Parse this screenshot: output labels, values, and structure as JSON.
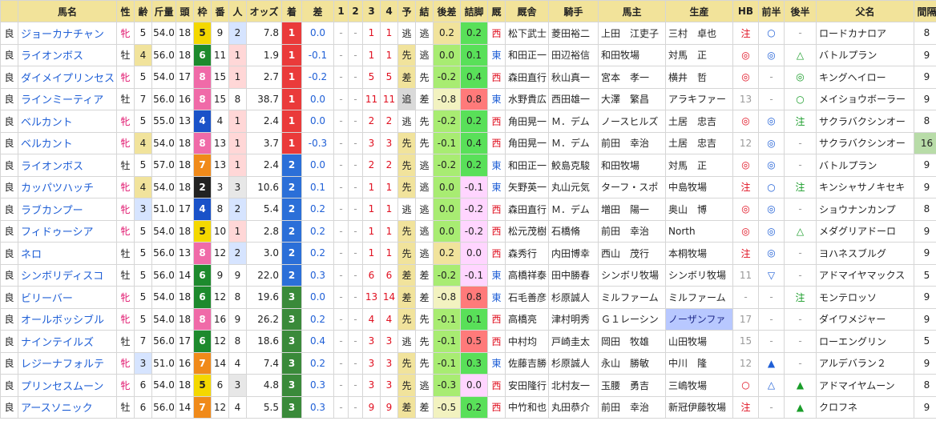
{
  "headers": [
    "",
    "馬名",
    "性",
    "齢",
    "斤量",
    "頭",
    "枠",
    "番",
    "人",
    "オッズ",
    "着",
    "差",
    "1",
    "2",
    "3",
    "4",
    "予",
    "結",
    "後差",
    "詰脚",
    "厩",
    "厩舎",
    "騎手",
    "馬主",
    "生産",
    "HB",
    "前半",
    "後半",
    "父名",
    "間隔"
  ],
  "rows": [
    {
      "baba": "良",
      "name": "ジョーカナチャン",
      "sex": "牝",
      "age": "5",
      "kin": "54.0",
      "tou": "18",
      "waku": "5",
      "ban": "9",
      "ninki": "2",
      "odds": "7.8",
      "chaku": "1",
      "sa": "0.0",
      "c1": "-",
      "c2": "-",
      "c3": "1",
      "c4": "1",
      "yo": "逃",
      "ke": "逃",
      "kosa": "0.2",
      "tsume": "0.2",
      "ew": "西",
      "stable": "松下武士",
      "jockey": "菱田裕二",
      "owner": "上田　江吏子",
      "breeder": "三村　卓也",
      "hb": "注",
      "zen": "○",
      "kou": "-",
      "sire": "ロードカナロア",
      "kankaku": "8"
    },
    {
      "baba": "良",
      "name": "ライオンボス",
      "sex": "牡",
      "age": "4",
      "kin": "56.0",
      "tou": "18",
      "waku": "6",
      "ban": "11",
      "ninki": "1",
      "odds": "1.9",
      "chaku": "1",
      "sa": "-0.1",
      "c1": "-",
      "c2": "-",
      "c3": "1",
      "c4": "1",
      "yo": "先",
      "ke": "逃",
      "kosa": "0.0",
      "tsume": "0.1",
      "ew": "東",
      "stable": "和田正一",
      "jockey": "田辺裕信",
      "owner": "和田牧場",
      "breeder": "対馬　正",
      "hb": "◎",
      "zen": "◎",
      "kou": "△",
      "sire": "バトルプラン",
      "kankaku": "9"
    },
    {
      "baba": "良",
      "name": "ダイメイプリンセス",
      "sex": "牝",
      "age": "5",
      "kin": "54.0",
      "tou": "17",
      "waku": "8",
      "ban": "15",
      "ninki": "1",
      "odds": "2.7",
      "chaku": "1",
      "sa": "-0.2",
      "c1": "-",
      "c2": "-",
      "c3": "5",
      "c4": "5",
      "yo": "差",
      "ke": "先",
      "kosa": "-0.2",
      "tsume": "0.4",
      "ew": "西",
      "stable": "森田直行",
      "jockey": "秋山真一",
      "owner": "宮本　孝一",
      "breeder": "横井　哲",
      "hb": "◎",
      "zen": "-",
      "kou": "◎",
      "sire": "キングヘイロー",
      "kankaku": "9"
    },
    {
      "baba": "良",
      "name": "ラインミーティア",
      "sex": "牡",
      "age": "7",
      "kin": "56.0",
      "tou": "16",
      "waku": "8",
      "ban": "15",
      "ninki": "8",
      "odds": "38.7",
      "chaku": "1",
      "sa": "0.0",
      "c1": "-",
      "c2": "-",
      "c3": "11",
      "c4": "11",
      "yo": "追",
      "ke": "差",
      "kosa": "-0.8",
      "tsume": "0.8",
      "ew": "東",
      "stable": "水野貴広",
      "jockey": "西田雄一",
      "owner": "大澤　繁昌",
      "breeder": "アラキファー",
      "hb": "13",
      "zen": "-",
      "kou": "○",
      "sire": "メイショウボーラー",
      "kankaku": "9"
    },
    {
      "baba": "良",
      "name": "ベルカント",
      "sex": "牝",
      "age": "5",
      "kin": "55.0",
      "tou": "13",
      "waku": "4",
      "ban": "4",
      "ninki": "1",
      "odds": "2.4",
      "chaku": "1",
      "sa": "0.0",
      "c1": "-",
      "c2": "-",
      "c3": "2",
      "c4": "2",
      "yo": "逃",
      "ke": "先",
      "kosa": "-0.2",
      "tsume": "0.2",
      "ew": "西",
      "stable": "角田晃一",
      "jockey": "Ｍ．デム",
      "owner": "ノースヒルズ",
      "breeder": "土居　忠吉",
      "hb": "◎",
      "zen": "◎",
      "kou": "注",
      "sire": "サクラバクシンオー",
      "kankaku": "8"
    },
    {
      "baba": "良",
      "name": "ベルカント",
      "sex": "牝",
      "age": "4",
      "kin": "54.0",
      "tou": "18",
      "waku": "8",
      "ban": "13",
      "ninki": "1",
      "odds": "3.7",
      "chaku": "1",
      "sa": "-0.3",
      "c1": "-",
      "c2": "-",
      "c3": "3",
      "c4": "3",
      "yo": "先",
      "ke": "先",
      "kosa": "-0.1",
      "tsume": "0.4",
      "ew": "西",
      "stable": "角田晃一",
      "jockey": "Ｍ．デム",
      "owner": "前田　幸治",
      "breeder": "土居　忠吉",
      "hb": "12",
      "zen": "◎",
      "kou": "-",
      "sire": "サクラバクシンオー",
      "kankaku": "16"
    },
    {
      "baba": "良",
      "name": "ライオンボス",
      "sex": "牡",
      "age": "5",
      "kin": "57.0",
      "tou": "18",
      "waku": "7",
      "ban": "13",
      "ninki": "1",
      "odds": "2.4",
      "chaku": "2",
      "sa": "0.0",
      "c1": "-",
      "c2": "-",
      "c3": "2",
      "c4": "2",
      "yo": "先",
      "ke": "逃",
      "kosa": "-0.2",
      "tsume": "0.2",
      "ew": "東",
      "stable": "和田正一",
      "jockey": "鮫島克駿",
      "owner": "和田牧場",
      "breeder": "対馬　正",
      "hb": "◎",
      "zen": "◎",
      "kou": "-",
      "sire": "バトルプラン",
      "kankaku": "9"
    },
    {
      "baba": "良",
      "name": "カッパツハッチ",
      "sex": "牝",
      "age": "4",
      "kin": "54.0",
      "tou": "18",
      "waku": "2",
      "ban": "3",
      "ninki": "3",
      "odds": "10.6",
      "chaku": "2",
      "sa": "0.1",
      "c1": "-",
      "c2": "-",
      "c3": "1",
      "c4": "1",
      "yo": "先",
      "ke": "逃",
      "kosa": "0.0",
      "tsume": "-0.1",
      "ew": "東",
      "stable": "矢野英一",
      "jockey": "丸山元気",
      "owner": "ターフ・スポ",
      "breeder": "中島牧場",
      "hb": "注",
      "zen": "○",
      "kou": "注",
      "sire": "キンシャサノキセキ",
      "kankaku": "9"
    },
    {
      "baba": "良",
      "name": "ラブカンプー",
      "sex": "牝",
      "age": "3",
      "kin": "51.0",
      "tou": "17",
      "waku": "4",
      "ban": "8",
      "ninki": "2",
      "odds": "5.4",
      "chaku": "2",
      "sa": "0.2",
      "c1": "-",
      "c2": "-",
      "c3": "1",
      "c4": "1",
      "yo": "逃",
      "ke": "逃",
      "kosa": "0.0",
      "tsume": "-0.2",
      "ew": "西",
      "stable": "森田直行",
      "jockey": "Ｍ．デム",
      "owner": "増田　陽一",
      "breeder": "奥山　博",
      "hb": "◎",
      "zen": "◎",
      "kou": "-",
      "sire": "ショウナンカンプ",
      "kankaku": "8"
    },
    {
      "baba": "良",
      "name": "フィドゥーシア",
      "sex": "牝",
      "age": "5",
      "kin": "54.0",
      "tou": "18",
      "waku": "5",
      "ban": "10",
      "ninki": "1",
      "odds": "2.8",
      "chaku": "2",
      "sa": "0.2",
      "c1": "-",
      "c2": "-",
      "c3": "1",
      "c4": "1",
      "yo": "先",
      "ke": "逃",
      "kosa": "0.0",
      "tsume": "-0.2",
      "ew": "西",
      "stable": "松元茂樹",
      "jockey": "石橋脩",
      "owner": "前田　幸治",
      "breeder": "North",
      "hb": "◎",
      "zen": "◎",
      "kou": "△",
      "sire": "メダグリアドーロ",
      "kankaku": "9"
    },
    {
      "baba": "良",
      "name": "ネロ",
      "sex": "牡",
      "age": "5",
      "kin": "56.0",
      "tou": "13",
      "waku": "8",
      "ban": "12",
      "ninki": "2",
      "odds": "3.0",
      "chaku": "2",
      "sa": "0.2",
      "c1": "-",
      "c2": "-",
      "c3": "1",
      "c4": "1",
      "yo": "先",
      "ke": "逃",
      "kosa": "0.2",
      "tsume": "0.0",
      "ew": "西",
      "stable": "森秀行",
      "jockey": "内田博幸",
      "owner": "西山　茂行",
      "breeder": "本桐牧場",
      "hb": "注",
      "zen": "◎",
      "kou": "-",
      "sire": "ヨハネスブルグ",
      "kankaku": "9"
    },
    {
      "baba": "良",
      "name": "シンボリディスコ",
      "sex": "牡",
      "age": "5",
      "kin": "56.0",
      "tou": "14",
      "waku": "6",
      "ban": "9",
      "ninki": "9",
      "odds": "22.0",
      "chaku": "2",
      "sa": "0.3",
      "c1": "-",
      "c2": "-",
      "c3": "6",
      "c4": "6",
      "yo": "差",
      "ke": "差",
      "kosa": "-0.2",
      "tsume": "-0.1",
      "ew": "東",
      "stable": "高橋祥泰",
      "jockey": "田中勝春",
      "owner": "シンボリ牧場",
      "breeder": "シンボリ牧場",
      "hb": "11",
      "zen": "▽",
      "kou": "-",
      "sire": "アドマイヤマックス",
      "kankaku": "5"
    },
    {
      "baba": "良",
      "name": "ビリーバー",
      "sex": "牝",
      "age": "5",
      "kin": "54.0",
      "tou": "18",
      "waku": "6",
      "ban": "12",
      "ninki": "8",
      "odds": "19.6",
      "chaku": "3",
      "sa": "0.0",
      "c1": "-",
      "c2": "-",
      "c3": "13",
      "c4": "14",
      "yo": "差",
      "ke": "差",
      "kosa": "-0.8",
      "tsume": "0.8",
      "ew": "東",
      "stable": "石毛善彦",
      "jockey": "杉原誠人",
      "owner": "ミルファーム",
      "breeder": "ミルファーム",
      "hb": "-",
      "zen": "-",
      "kou": "注",
      "sire": "モンテロッソ",
      "kankaku": "9"
    },
    {
      "baba": "良",
      "name": "オールボッシブル",
      "sex": "牝",
      "age": "5",
      "kin": "54.0",
      "tou": "18",
      "waku": "8",
      "ban": "16",
      "ninki": "9",
      "odds": "26.2",
      "chaku": "3",
      "sa": "0.2",
      "c1": "-",
      "c2": "-",
      "c3": "4",
      "c4": "4",
      "yo": "先",
      "ke": "先",
      "kosa": "-0.1",
      "tsume": "0.1",
      "ew": "西",
      "stable": "高橋亮",
      "jockey": "津村明秀",
      "owner": "Ｇ１レーシン",
      "breeder": "ノーザンファ",
      "hb": "17",
      "zen": "-",
      "kou": "-",
      "sire": "ダイワメジャー",
      "kankaku": "9"
    },
    {
      "baba": "良",
      "name": "ナインテイルズ",
      "sex": "牡",
      "age": "7",
      "kin": "56.0",
      "tou": "17",
      "waku": "6",
      "ban": "12",
      "ninki": "8",
      "odds": "18.6",
      "chaku": "3",
      "sa": "0.4",
      "c1": "-",
      "c2": "-",
      "c3": "3",
      "c4": "3",
      "yo": "逃",
      "ke": "先",
      "kosa": "-0.1",
      "tsume": "0.5",
      "ew": "西",
      "stable": "中村均",
      "jockey": "戸崎圭太",
      "owner": "岡田　牧雄",
      "breeder": "山田牧場",
      "hb": "15",
      "zen": "-",
      "kou": "-",
      "sire": "ローエングリン",
      "kankaku": "5"
    },
    {
      "baba": "良",
      "name": "レジーナフォルテ",
      "sex": "牝",
      "age": "3",
      "kin": "51.0",
      "tou": "16",
      "waku": "7",
      "ban": "14",
      "ninki": "4",
      "odds": "7.4",
      "chaku": "3",
      "sa": "0.2",
      "c1": "-",
      "c2": "-",
      "c3": "3",
      "c4": "3",
      "yo": "先",
      "ke": "先",
      "kosa": "-0.1",
      "tsume": "0.3",
      "ew": "東",
      "stable": "佐藤吉勝",
      "jockey": "杉原誠人",
      "owner": "永山　勝敏",
      "breeder": "中川　隆",
      "hb": "12",
      "zen": "▲",
      "kou": "-",
      "sire": "アルデバラン２",
      "kankaku": "9"
    },
    {
      "baba": "良",
      "name": "プリンセスムーン",
      "sex": "牝",
      "age": "6",
      "kin": "54.0",
      "tou": "18",
      "waku": "5",
      "ban": "6",
      "ninki": "3",
      "odds": "4.8",
      "chaku": "3",
      "sa": "0.3",
      "c1": "-",
      "c2": "-",
      "c3": "3",
      "c4": "3",
      "yo": "先",
      "ke": "逃",
      "kosa": "-0.3",
      "tsume": "0.0",
      "ew": "西",
      "stable": "安田隆行",
      "jockey": "北村友一",
      "owner": "玉腰　勇吉",
      "breeder": "三嶋牧場",
      "hb": "○",
      "zen": "△",
      "kou": "▲",
      "sire": "アドマイヤムーン",
      "kankaku": "8"
    },
    {
      "baba": "良",
      "name": "アースソニック",
      "sex": "牡",
      "age": "6",
      "kin": "56.0",
      "tou": "14",
      "waku": "7",
      "ban": "12",
      "ninki": "4",
      "odds": "5.5",
      "chaku": "3",
      "sa": "0.3",
      "c1": "-",
      "c2": "-",
      "c3": "9",
      "c4": "9",
      "yo": "差",
      "ke": "差",
      "kosa": "-0.5",
      "tsume": "0.2",
      "ew": "西",
      "stable": "中竹和也",
      "jockey": "丸田恭介",
      "owner": "前田　幸治",
      "breeder": "新冠伊藤牧場",
      "hb": "注",
      "zen": "-",
      "kou": "▲",
      "sire": "クロフネ",
      "kankaku": "9"
    }
  ]
}
